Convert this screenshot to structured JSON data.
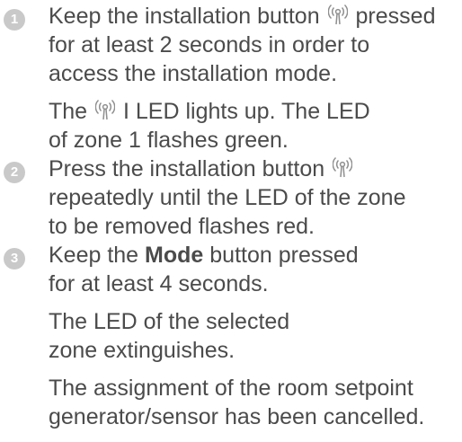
{
  "steps": [
    {
      "number": "1",
      "paragraphs": [
        {
          "lines": [
            {
              "before": "Keep the installation button",
              "icon": "antenna-icon",
              "after": "pressed"
            },
            {
              "text": "for at least 2 seconds in order to"
            },
            {
              "text": "access the installation mode."
            }
          ]
        },
        {
          "lines": [
            {
              "before": "The",
              "icon": "antenna-icon",
              "after": "I LED lights up. The LED"
            },
            {
              "text": "of zone 1 flashes green."
            }
          ]
        }
      ]
    },
    {
      "number": "2",
      "paragraphs": [
        {
          "lines": [
            {
              "before": "Press the installation button",
              "icon": "antenna-icon",
              "after": ""
            },
            {
              "text": "repeatedly until the LED of the zone"
            },
            {
              "text": "to be removed flashes red."
            }
          ]
        }
      ]
    },
    {
      "number": "3",
      "paragraphs": [
        {
          "lines": [
            {
              "before": "Keep the",
              "bold": "Mode",
              "after": "button pressed"
            },
            {
              "text": "for at least 4 seconds."
            }
          ]
        },
        {
          "lines": [
            {
              "text": "The LED of the selected"
            },
            {
              "text": "zone extinguishes."
            }
          ]
        },
        {
          "lines": [
            {
              "text": "The assignment of the room setpoint"
            },
            {
              "text": "generator/sensor has been cancelled."
            }
          ]
        }
      ]
    }
  ]
}
